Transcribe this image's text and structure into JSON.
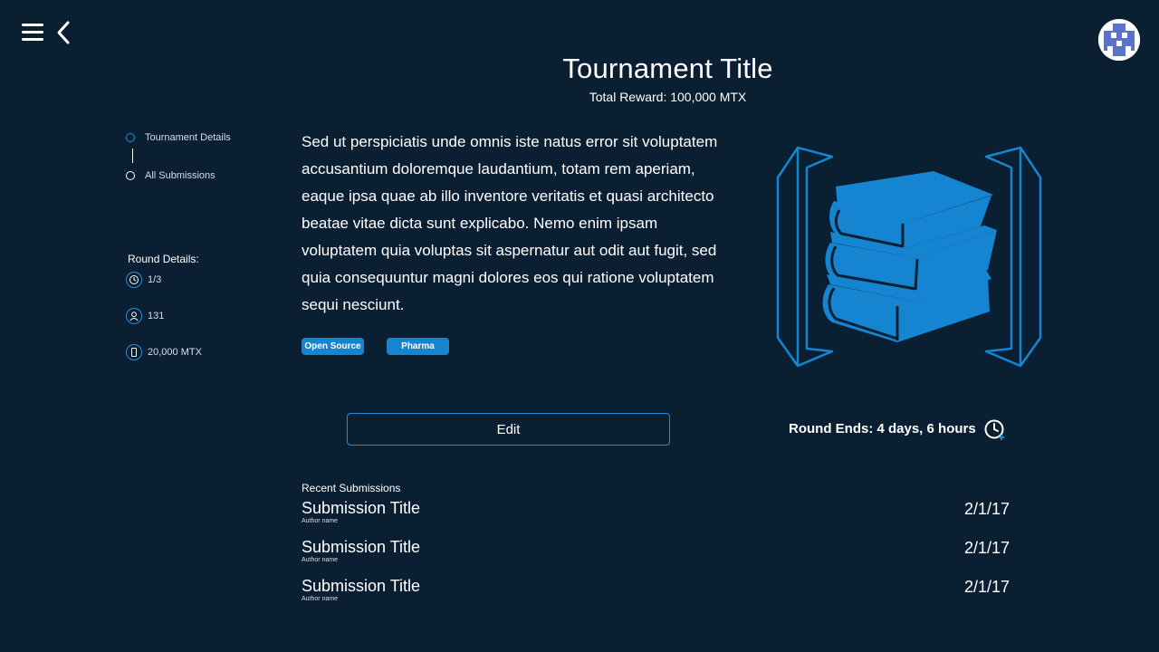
{
  "header": {
    "title": "Tournament Title",
    "total_reward": "Total Reward: 100,000 MTX"
  },
  "nav": {
    "items": [
      {
        "label": "Tournament Details",
        "active": true
      },
      {
        "label": "All Submissions",
        "active": false
      }
    ]
  },
  "round_details": {
    "heading": "Round Details:",
    "round": {
      "icon": "round-icon",
      "value": "1/3"
    },
    "participants": {
      "icon": "user-icon",
      "value": "131"
    },
    "prize": {
      "icon": "prize-icon",
      "value": "20,000 MTX"
    }
  },
  "description": "Sed ut perspiciatis unde omnis iste natus error sit voluptatem accusantium doloremque laudantium, totam rem aperiam, eaque ipsa quae ab illo inventore veritatis et quasi architecto beatae vitae dicta sunt explicabo. Nemo enim ipsam voluptatem quia voluptas sit aspernatur aut odit aut fugit, sed quia consequuntur magni dolores eos qui ratione voluptatem sequi nesciunt.",
  "tags": [
    "Open Source",
    "Pharma"
  ],
  "actions": {
    "edit_label": "Edit",
    "round_ends": "Round Ends: 4 days, 6 hours"
  },
  "submissions": {
    "heading": "Recent Submissions",
    "items": [
      {
        "title": "Submission Title",
        "author": "Author name",
        "date": "2/1/17"
      },
      {
        "title": "Submission Title",
        "author": "Author name",
        "date": "2/1/17"
      },
      {
        "title": "Submission Title",
        "author": "Author name",
        "date": "2/1/17"
      }
    ]
  },
  "colors": {
    "background": "#0b1f33",
    "accent": "#1585d2",
    "text": "#ffffff"
  },
  "icons": [
    "menu-icon",
    "back-icon",
    "avatar",
    "books-icon",
    "clock-icon"
  ]
}
